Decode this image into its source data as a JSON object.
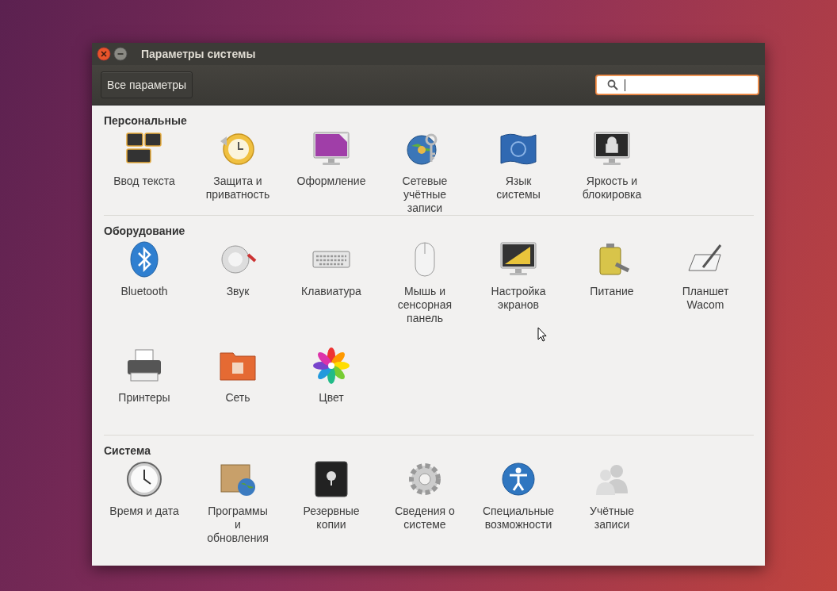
{
  "window": {
    "title": "Параметры системы"
  },
  "toolbar": {
    "all_settings_button": "Все параметры",
    "search": {
      "focused": true
    }
  },
  "sections": [
    {
      "title": "Персональные",
      "items": [
        {
          "label": "Ввод текста"
        },
        {
          "label": "Защита и\nприватность"
        },
        {
          "label": "Оформление"
        },
        {
          "label": "Сетевые\nучётные\nзаписи"
        },
        {
          "label": "Язык\nсистемы"
        },
        {
          "label": "Яркость и\nблокировка"
        }
      ]
    },
    {
      "title": "Оборудование",
      "items": [
        {
          "label": "Bluetooth"
        },
        {
          "label": "Звук"
        },
        {
          "label": "Клавиатура"
        },
        {
          "label": "Мышь и\nсенсорная\nпанель"
        },
        {
          "label": "Настройка\nэкранов"
        },
        {
          "label": "Питание"
        },
        {
          "label": "Планшет\nWacom"
        },
        {
          "label": "Принтеры"
        },
        {
          "label": "Сеть"
        },
        {
          "label": "Цвет"
        }
      ]
    },
    {
      "title": "Система",
      "items": [
        {
          "label": "Время и дата"
        },
        {
          "label": "Программы\nи\nобновления"
        },
        {
          "label": "Резервные\nкопии"
        },
        {
          "label": "Сведения о\nсистеме"
        },
        {
          "label": "Специальные\nвозможности"
        },
        {
          "label": "Учётные\nзаписи"
        }
      ]
    }
  ]
}
